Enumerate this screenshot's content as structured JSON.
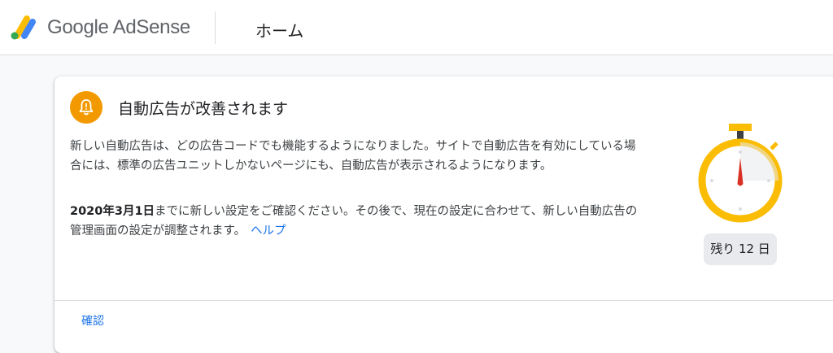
{
  "header": {
    "brand": "Google AdSense",
    "page_title": "ホーム"
  },
  "notice": {
    "title": "自動広告が改善されます",
    "body1": "新しい自動広告は、どの広告コードでも機能するようになりました。サイトで自動広告を有効にしている場合には、標準の広告ユニットしかないページにも、自動広告が表示されるようになります。",
    "date_bold": "2020年3月1日",
    "body2": "までに新しい設定をご確認ください。その後で、現在の設定に合わせて、新しい自動広告の管理画面の設定が調整されます。",
    "help_link": "ヘルプ",
    "days_left": "残り 12 日",
    "confirm_button": "確認"
  },
  "icons": {
    "logo": "adsense-logo-icon",
    "notice": "bell-icon",
    "timer": "stopwatch-icon"
  },
  "colors": {
    "accent_orange": "#f29900",
    "stopwatch_ring": "#fbbc04",
    "hand_red": "#d93025",
    "link_blue": "#1a73e8",
    "logo_yellow": "#fbbc04",
    "logo_green": "#34a853",
    "logo_blue": "#4285f4"
  }
}
